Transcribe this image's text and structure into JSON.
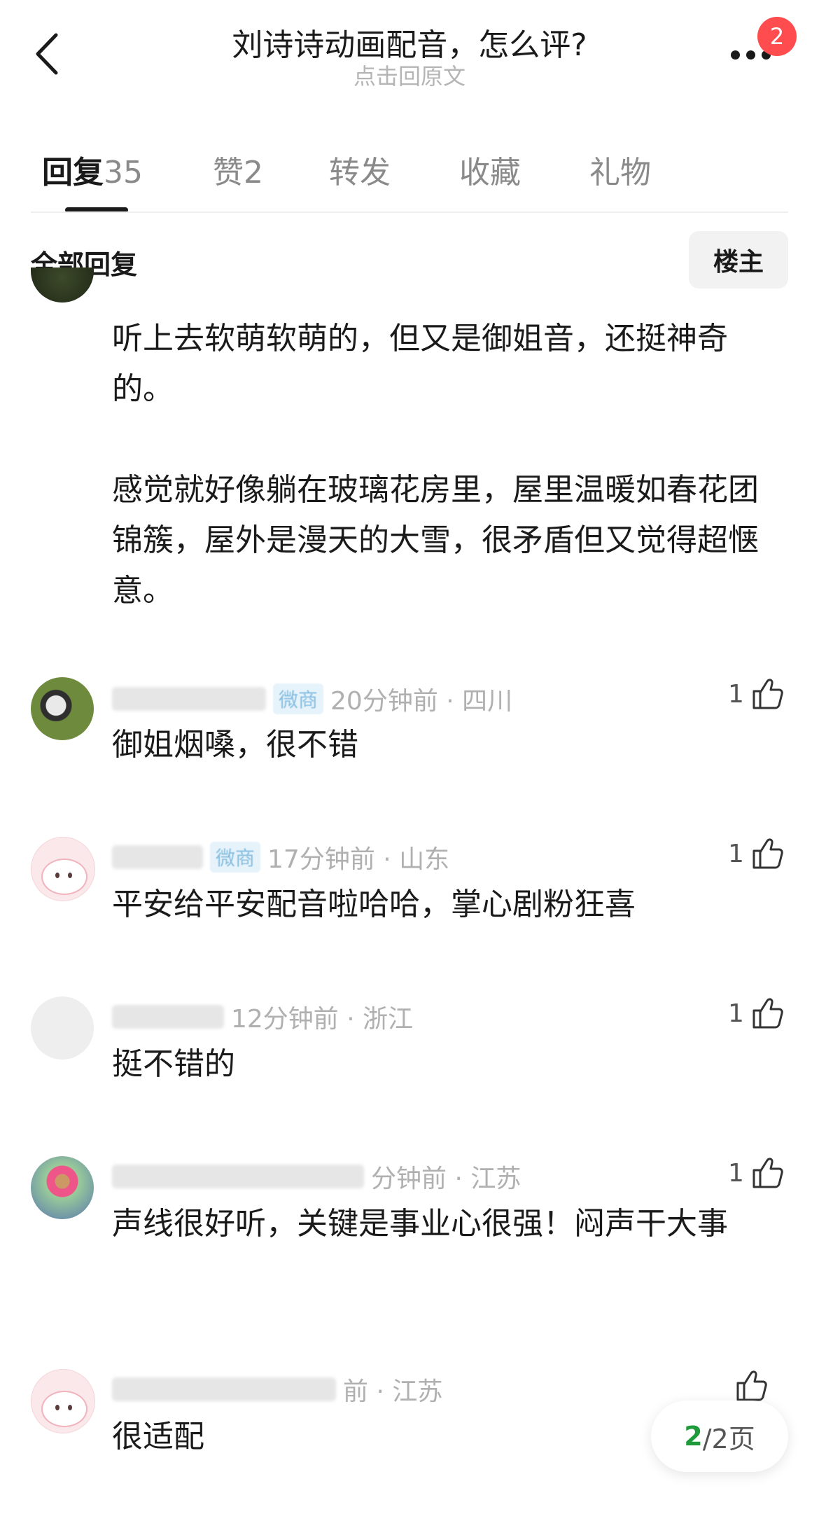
{
  "header": {
    "title": "刘诗诗动画配音，怎么评?",
    "subtitle": "点击回原文",
    "badge_count": "2"
  },
  "tabs": [
    {
      "label": "回复",
      "count": "35",
      "active": true
    },
    {
      "label": "赞",
      "count": "2"
    },
    {
      "label": "转发",
      "count": ""
    },
    {
      "label": "收藏",
      "count": ""
    },
    {
      "label": "礼物",
      "count": ""
    }
  ],
  "section": {
    "title": "全部回复",
    "owner_button": "楼主"
  },
  "comments": [
    {
      "text": "听上去软萌软萌的，但又是御姐音，还挺神奇的。\n\n感觉就好像躺在玻璃花房里，屋里温暖如春花团锦簇，屋外是漫天的大雪，很矛盾但又觉得超惬意。"
    },
    {
      "tag": "微商",
      "time_location": "20分钟前 · 四川",
      "likes": "1",
      "text": "御姐烟嗓，很不错"
    },
    {
      "tag": "微商",
      "time_location": "17分钟前 · 山东",
      "likes": "1",
      "text": "平安给平安配音啦哈哈，掌心剧粉狂喜"
    },
    {
      "time_location": "12分钟前 · 浙江",
      "likes": "1",
      "text": "挺不错的"
    },
    {
      "time_location": "分钟前 · 江苏",
      "likes": "1",
      "text": "声线很好听，关键是事业心很强！闷声干大事"
    },
    {
      "time_location": "前 · 江苏",
      "likes": "",
      "text": "很适配"
    }
  ],
  "pager": {
    "current": "2",
    "total": "/2页"
  }
}
